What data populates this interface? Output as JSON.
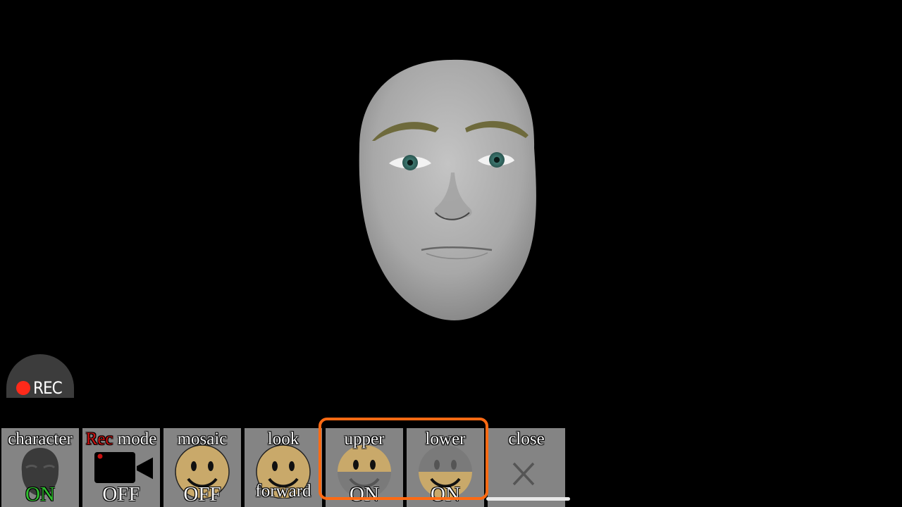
{
  "rec_button": {
    "label": "REC",
    "dot_color": "#ff2a1a"
  },
  "toolbar": {
    "character": {
      "label": "character",
      "state": "ON"
    },
    "rec_mode": {
      "label_rec": "Rec",
      "label_mode": " mode",
      "state": "OFF"
    },
    "mosaic": {
      "label": "mosaic",
      "state": "OFF"
    },
    "look_forward": {
      "label_top": "look",
      "label_bottom": "forward"
    },
    "upper": {
      "label": "upper",
      "state": "ON"
    },
    "lower": {
      "label": "lower",
      "state": "ON"
    },
    "close": {
      "label": "close",
      "icon": "close-icon"
    }
  },
  "colors": {
    "on_state": "#2fbf2f",
    "rec_word": "#c81010",
    "highlight": "#ff6a13",
    "button_bg": "#848484",
    "smiley_face": "#c9a96a"
  }
}
